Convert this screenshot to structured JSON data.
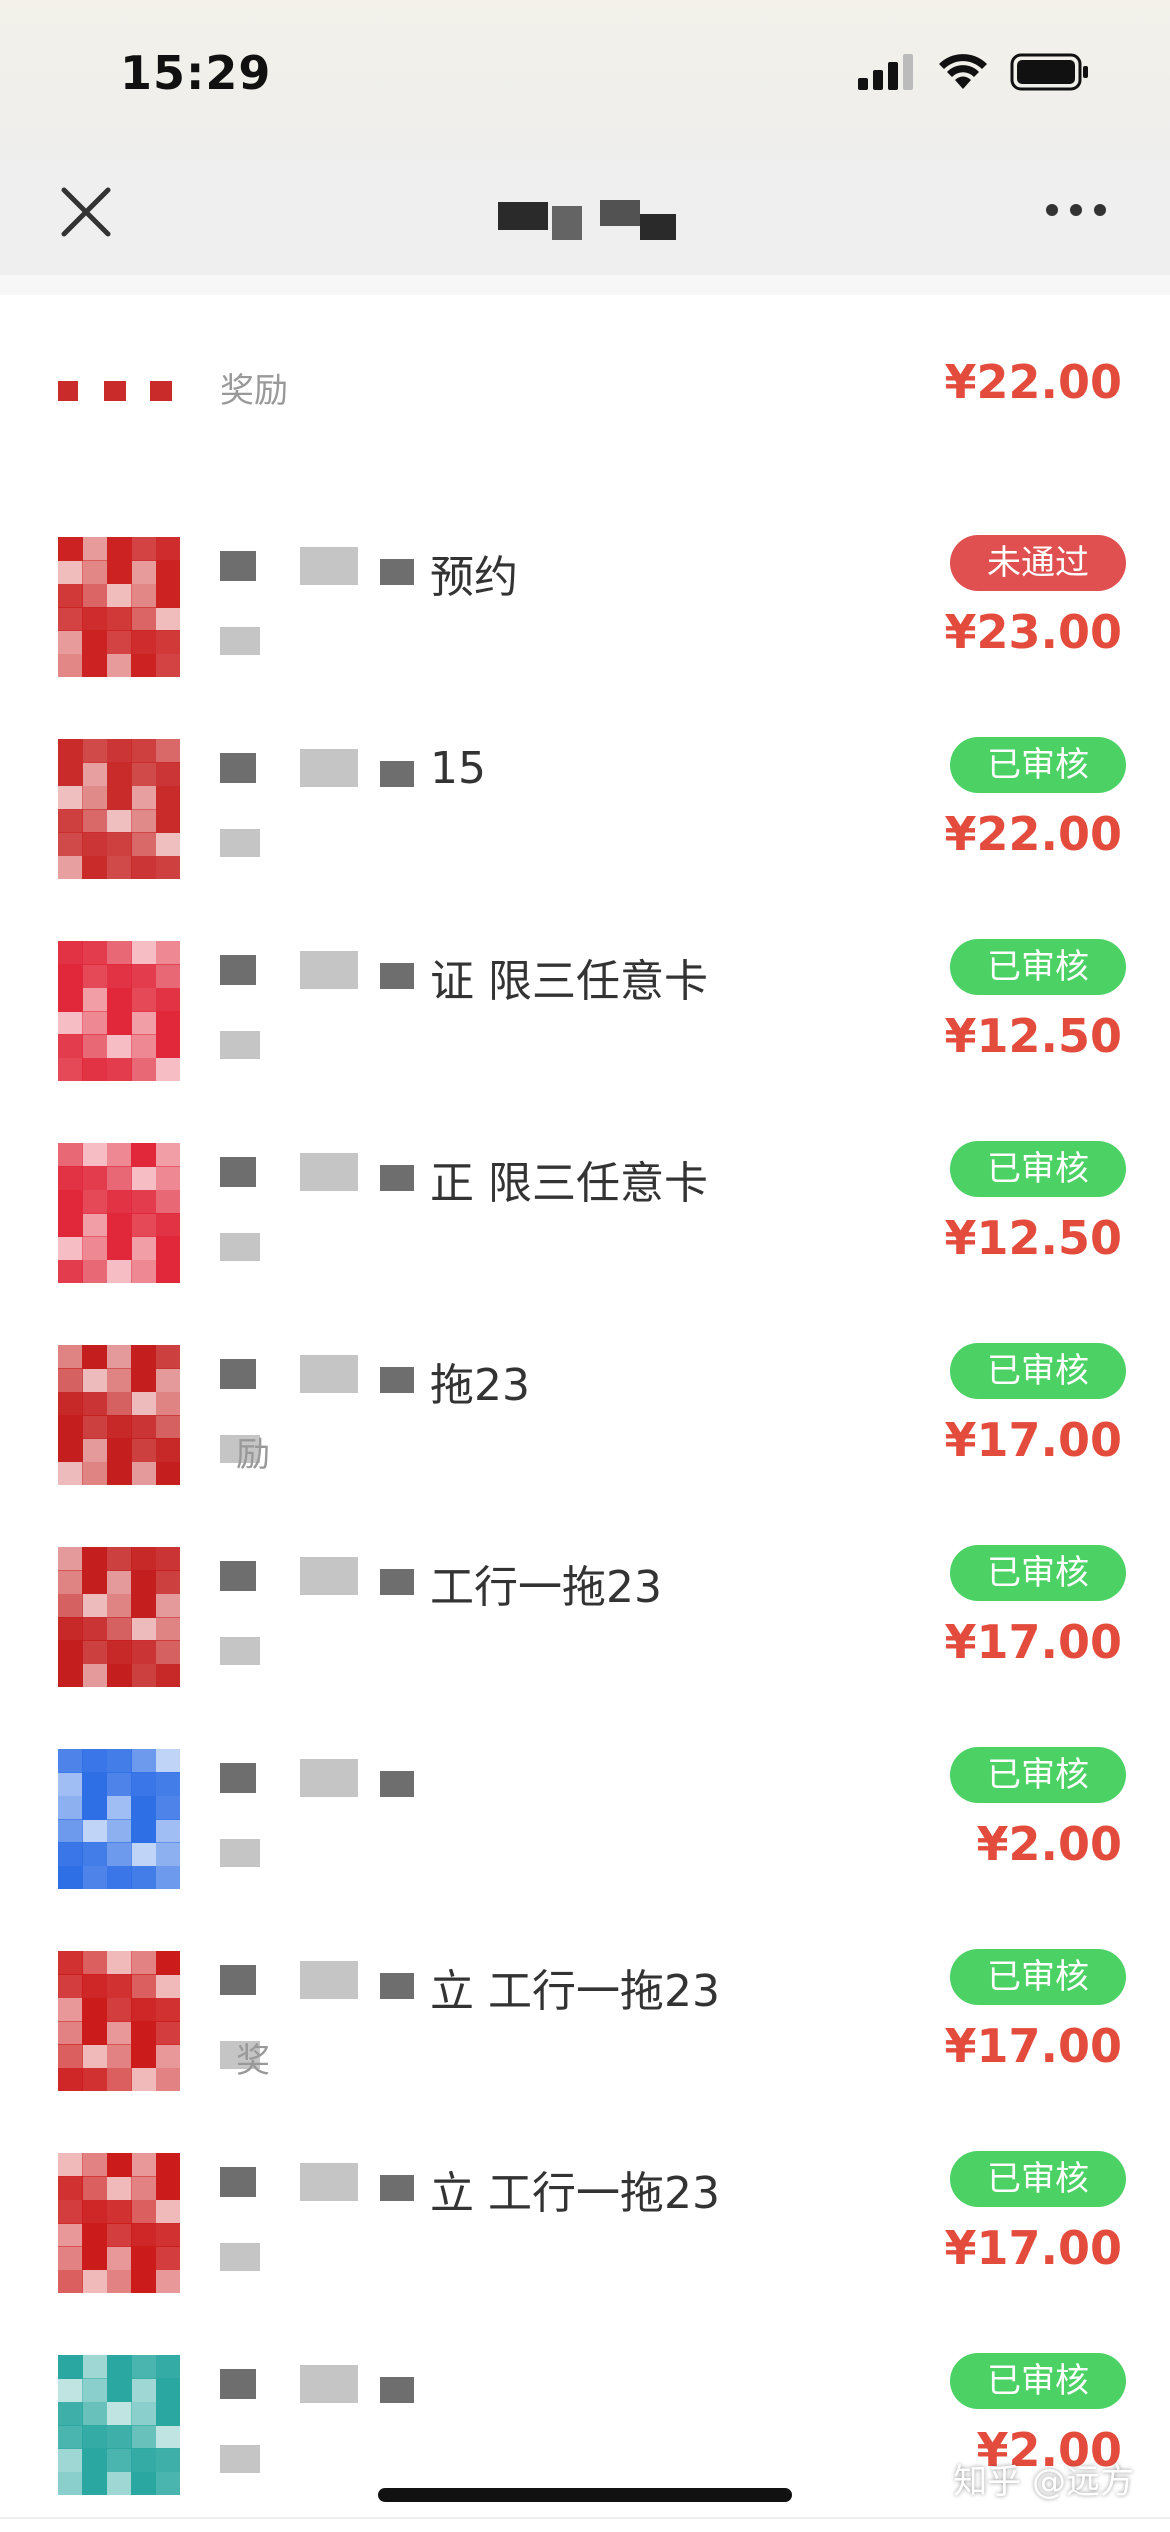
{
  "status_bar": {
    "time": "15:29"
  },
  "list": {
    "partial_row": {
      "subtitle": "奖励",
      "price": "¥22.00"
    },
    "rows": [
      {
        "title": "预约",
        "subtitle": "",
        "status": "未通过",
        "status_type": "fail",
        "price": "¥23.00",
        "thumb_color": "#cc2222"
      },
      {
        "title": "15",
        "subtitle": "",
        "status": "已审核",
        "status_type": "ok",
        "price": "¥22.00",
        "thumb_color": "#c92a2a"
      },
      {
        "title": "证 限三任意卡",
        "subtitle": "",
        "status": "已审核",
        "status_type": "ok",
        "price": "¥12.50",
        "thumb_color": "#e0283a"
      },
      {
        "title": "正 限三任意卡",
        "subtitle": "",
        "status": "已审核",
        "status_type": "ok",
        "price": "¥12.50",
        "thumb_color": "#e0283a"
      },
      {
        "title": "拖23",
        "subtitle": "励",
        "status": "已审核",
        "status_type": "ok",
        "price": "¥17.00",
        "thumb_color": "#c41e1e"
      },
      {
        "title": "工行一拖23",
        "subtitle": "",
        "status": "已审核",
        "status_type": "ok",
        "price": "¥17.00",
        "thumb_color": "#c41e1e"
      },
      {
        "title": "",
        "subtitle": "",
        "status": "已审核",
        "status_type": "ok",
        "price": "¥2.00",
        "thumb_color": "#2f6fe6"
      },
      {
        "title": "立 工行一拖23",
        "subtitle": "奖",
        "status": "已审核",
        "status_type": "ok",
        "price": "¥17.00",
        "thumb_color": "#cc1b1b"
      },
      {
        "title": "立 工行一拖23",
        "subtitle": "",
        "status": "已审核",
        "status_type": "ok",
        "price": "¥17.00",
        "thumb_color": "#cc1b1b"
      },
      {
        "title": "",
        "subtitle": "",
        "status": "已审核",
        "status_type": "ok",
        "price": "¥2.00",
        "thumb_color": "#2aa7a0"
      }
    ]
  },
  "watermark": "知乎 @远方"
}
